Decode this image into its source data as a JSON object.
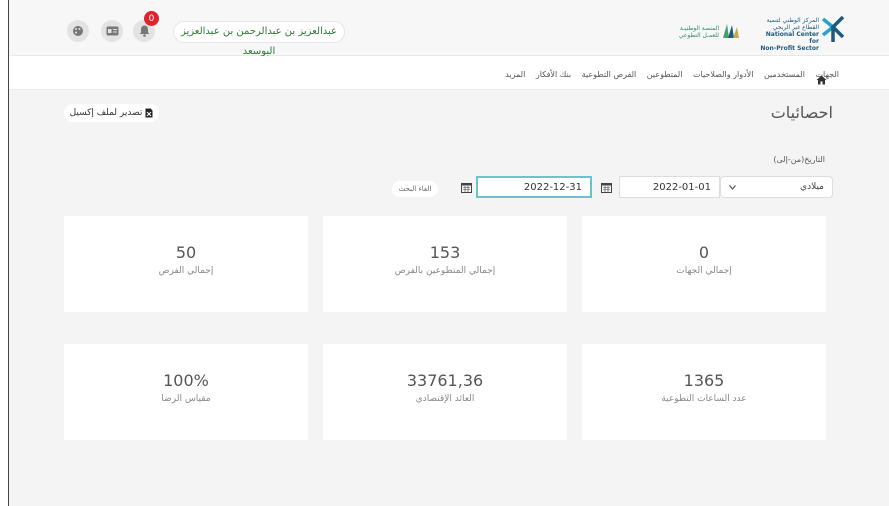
{
  "header": {
    "user_name": "عبدالعزيز بن عبدالرحمن بن عبدالعزيز البوسعد",
    "notification_count": "0",
    "logo1_lines": [
      "المنصة الوطنيـة",
      "للعمـل التطوعي"
    ],
    "logo2_lines": [
      "المركز الوطني لتنمية",
      "القطاع غير الربحي",
      "National Center for",
      "Non-Profit Sector"
    ]
  },
  "nav": {
    "items": [
      "الجهات",
      "المستخدمين",
      "الأدوار والصلاحيات",
      "المتطوعين",
      "الفرص التطوعية",
      "بنك الأفكار",
      "المزيد"
    ]
  },
  "page": {
    "title": "احصائيات",
    "export_label": "تصدير لملف إكسيل"
  },
  "filters": {
    "date_label": "التاريخ(من-إلى)",
    "calendar_type": "ميلادي",
    "from_date": "2022-01-01",
    "to_date": "2022-12-31",
    "reset_label": "الغاء البحث"
  },
  "stats": [
    {
      "value": "0",
      "label": "إجمالي الجهات"
    },
    {
      "value": "153",
      "label": "إجمالي المتطوعين بالفرص"
    },
    {
      "value": "50",
      "label": "إجمالي الفرص"
    },
    {
      "value": "1365",
      "label": "عدد الساعات التطوعية"
    },
    {
      "value": "33761,36",
      "label": "العائد الإقتصادي"
    },
    {
      "value": "100%",
      "label": "مقياس الرضا"
    }
  ],
  "colors": {
    "accent": "#6cc3cc",
    "user_text": "#2d7a34",
    "badge": "#e0242e"
  }
}
